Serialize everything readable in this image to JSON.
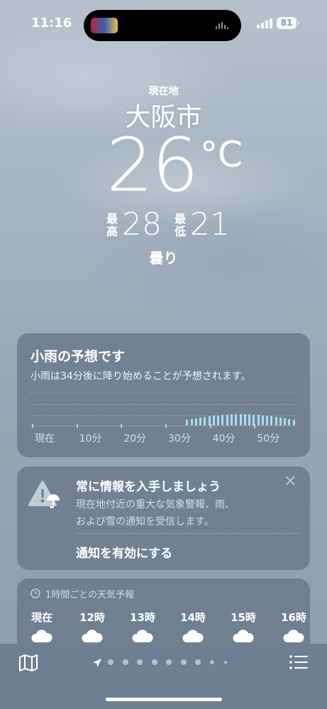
{
  "status": {
    "time": "11:16",
    "battery": "81"
  },
  "hero": {
    "location_label": "現在地",
    "city": "大阪市",
    "temperature": "26",
    "temperature_unit": "°C",
    "high_label": "最高",
    "high": "28",
    "low_label": "最低",
    "low": "21",
    "condition": "曇り"
  },
  "precip_card": {
    "title": "小雨の予想です",
    "subtitle": "小雨は34分後に降り始めることが予想されます。",
    "ticks": [
      "現在",
      "10分",
      "20分",
      "30分",
      "40分",
      "50分"
    ],
    "minutes": 60,
    "rain_start_minute": 34
  },
  "notify_card": {
    "title": "常に情報を入手しましょう",
    "body_line1": "現在地付近の重大な気象警報、雨、",
    "body_line2": "および雪の通知を受信します。",
    "close": "✕",
    "action": "通知を有効にする"
  },
  "hourly_card": {
    "title": "1時間ごとの天気予報",
    "hours": [
      {
        "label": "現在",
        "icon": "cloud-icon"
      },
      {
        "label": "12時",
        "icon": "cloud-rain-icon"
      },
      {
        "label": "13時",
        "icon": "cloud-icon"
      },
      {
        "label": "14時",
        "icon": "cloud-icon"
      },
      {
        "label": "15時",
        "icon": "cloud-icon"
      },
      {
        "label": "16時",
        "icon": "cloud-icon"
      }
    ]
  },
  "bottom_bar": {
    "icons": [
      "map-icon",
      "location-arrow-icon",
      "list-icon"
    ],
    "page_dots": 9,
    "active_page": 0
  },
  "colors": {
    "rain_bar": "#a9dcf5",
    "card_bg": "#687789"
  }
}
